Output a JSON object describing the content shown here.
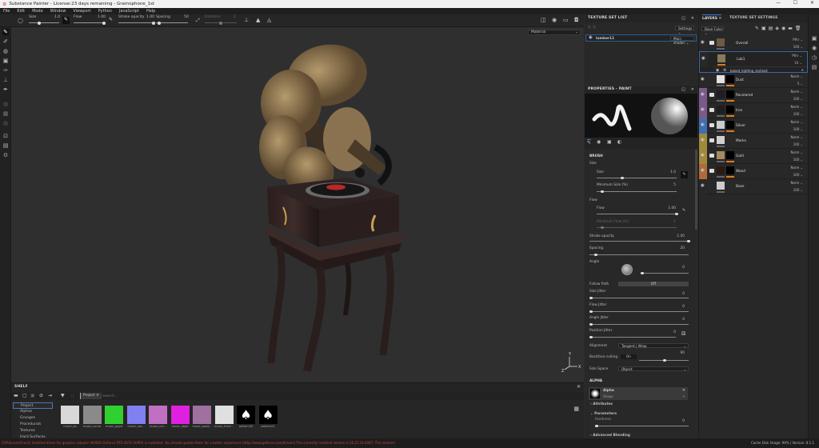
{
  "title": "Substance Painter - License:23 days remaining - Gramophone_1st",
  "window_controls": {
    "minimize": "—",
    "maximize": "☐",
    "close": "✕"
  },
  "menu": [
    "File",
    "Edit",
    "Mode",
    "Window",
    "Viewport",
    "Python",
    "JavaScript",
    "Help"
  ],
  "tool_options": {
    "size_label": "Size",
    "size_value": "1.0",
    "flow_label": "Flow",
    "flow_value": "1.00",
    "stroke_opacity_label": "Stroke opacity",
    "stroke_opacity_value": "1.00",
    "spacing_label": "Spacing",
    "spacing_value": "50",
    "distance_label": "Distance",
    "distance_value": "1"
  },
  "viewport": {
    "material_mode": "Material",
    "axis_labels": {
      "x": "X",
      "y": "Y",
      "z": "Z"
    }
  },
  "texture_set_list": {
    "title": "TEXTURE SET LIST",
    "settings_label": "Settings",
    "item_name": "lumber11",
    "shader": "Main shader"
  },
  "properties": {
    "title": "PROPERTIES - PAINT",
    "brush": "BRUSH",
    "size_group": "Size",
    "size": "Size",
    "size_value": "1.0",
    "min_size": "Minimum Size (%)",
    "min_size_value": "5",
    "flow_group": "Flow",
    "flow": "Flow",
    "flow_value": "1.00",
    "min_flow": "Minimum Flow (%)",
    "min_flow_value": "1",
    "stroke_opacity": "Stroke opacity",
    "stroke_opacity_value": "1.00",
    "spacing": "Spacing",
    "spacing_value": "20",
    "angle": "Angle",
    "angle_value": "0",
    "follow_path": "Follow Path",
    "follow_path_value": "Off",
    "size_jitter": "Size Jitter",
    "size_jitter_value": "0",
    "flow_jitter": "Flow Jitter",
    "flow_jitter_value": "0",
    "angle_jitter": "Angle Jitter",
    "angle_jitter_value": "0",
    "position_jitter": "Position Jitter",
    "position_jitter_value": "0",
    "alignment": "Alignment",
    "alignment_value": "Tangent | Wrap",
    "backface": "Backface culling",
    "backface_value": "On",
    "backface_angle": "90",
    "size_space": "Size Space",
    "size_space_value": "Object",
    "alpha_header": "ALPHA",
    "alpha_name": "Alpha",
    "alpha_type": "Shape",
    "attributes": "Attributes",
    "parameters": "Parameters",
    "hardness": "Hardness",
    "hardness_value": "0",
    "advanced_blending": "Advanced Blending"
  },
  "layers_panel": {
    "tab_layers": "LAYERS",
    "tab_tss": "TEXTURE SET SETTINGS",
    "channel": "Base Color",
    "effect_name": "baked_lighting_stylized",
    "layers": [
      {
        "name": "Overall",
        "blend": "Pthr",
        "opacity": "100",
        "color": "#282828",
        "thumb": "#6b5a44",
        "folder": true
      },
      {
        "name": "Lab1",
        "blend": "Pthr",
        "opacity": "10",
        "color": "#282828",
        "thumb": "#8a7a5c",
        "folder": false,
        "selected": true
      },
      {
        "name": "Dust",
        "blend": "Norm",
        "opacity": "5",
        "color": "#282828",
        "thumb": "#e8e0e0",
        "folder": false
      },
      {
        "name": "Recolored",
        "blend": "Norm",
        "opacity": "100",
        "color": "#7a5a8a",
        "thumb": "#1e1e24",
        "folder": true
      },
      {
        "name": "Iron",
        "blend": "Norm",
        "opacity": "100",
        "color": "#7a5a8a",
        "thumb": "#1e1e1e",
        "folder": true
      },
      {
        "name": "Silver",
        "blend": "Norm",
        "opacity": "100",
        "color": "#3f6fb0",
        "thumb": "#c8cccc",
        "folder": true
      },
      {
        "name": "Marks",
        "blend": "Norm",
        "opacity": "100",
        "color": "#a08a3a",
        "thumb": "#cfcfcf",
        "folder": true
      },
      {
        "name": "Gold",
        "blend": "Norm",
        "opacity": "100",
        "color": "#a08a3a",
        "thumb": "#a88a60",
        "folder": true
      },
      {
        "name": "Wood",
        "blend": "Norm",
        "opacity": "100",
        "color": "#b06a3a",
        "thumb": "#2a1a14",
        "folder": true
      },
      {
        "name": "Base",
        "blend": "Norm",
        "opacity": "100",
        "color": "#282828",
        "thumb": "#cccccc",
        "folder": false
      }
    ]
  },
  "shelf": {
    "title": "SHELF",
    "filter_tag": "Project",
    "search_placeholder": "Search...",
    "categories": [
      "Project",
      "Alphas",
      "Grunges",
      "Procedurals",
      "Textures",
      "Hard Surfaces"
    ],
    "items": [
      {
        "name": "music_ao",
        "color": "#d8d8d8"
      },
      {
        "name": "music_curva",
        "color": "#8a8a8a"
      },
      {
        "name": "music_gapd",
        "color": "#30d030"
      },
      {
        "name": "music_nor...",
        "color": "#8080f0"
      },
      {
        "name": "music_nor...",
        "color": "#c070c0"
      },
      {
        "name": "music_objid",
        "color": "#e020e0"
      },
      {
        "name": "music_posit...",
        "color": "#a070a0"
      },
      {
        "name": "music_thick...",
        "color": "#e0e0e0"
      },
      {
        "name": "pattern00",
        "color": "#000000"
      },
      {
        "name": "pattern01",
        "color": "#000000"
      }
    ]
  },
  "status": {
    "message": "[GPUIssuesCheck] Installed driver for graphics adapter NVIDIA GeForce RTX 2070 SUPER is outdated. You should update them for a better experience (http://www.geforce.com/drivers) The currently installed version is 26.21.14.4087. The recomm",
    "version": "Cache Disk Usage: 94% | Version: 8.1.1"
  }
}
